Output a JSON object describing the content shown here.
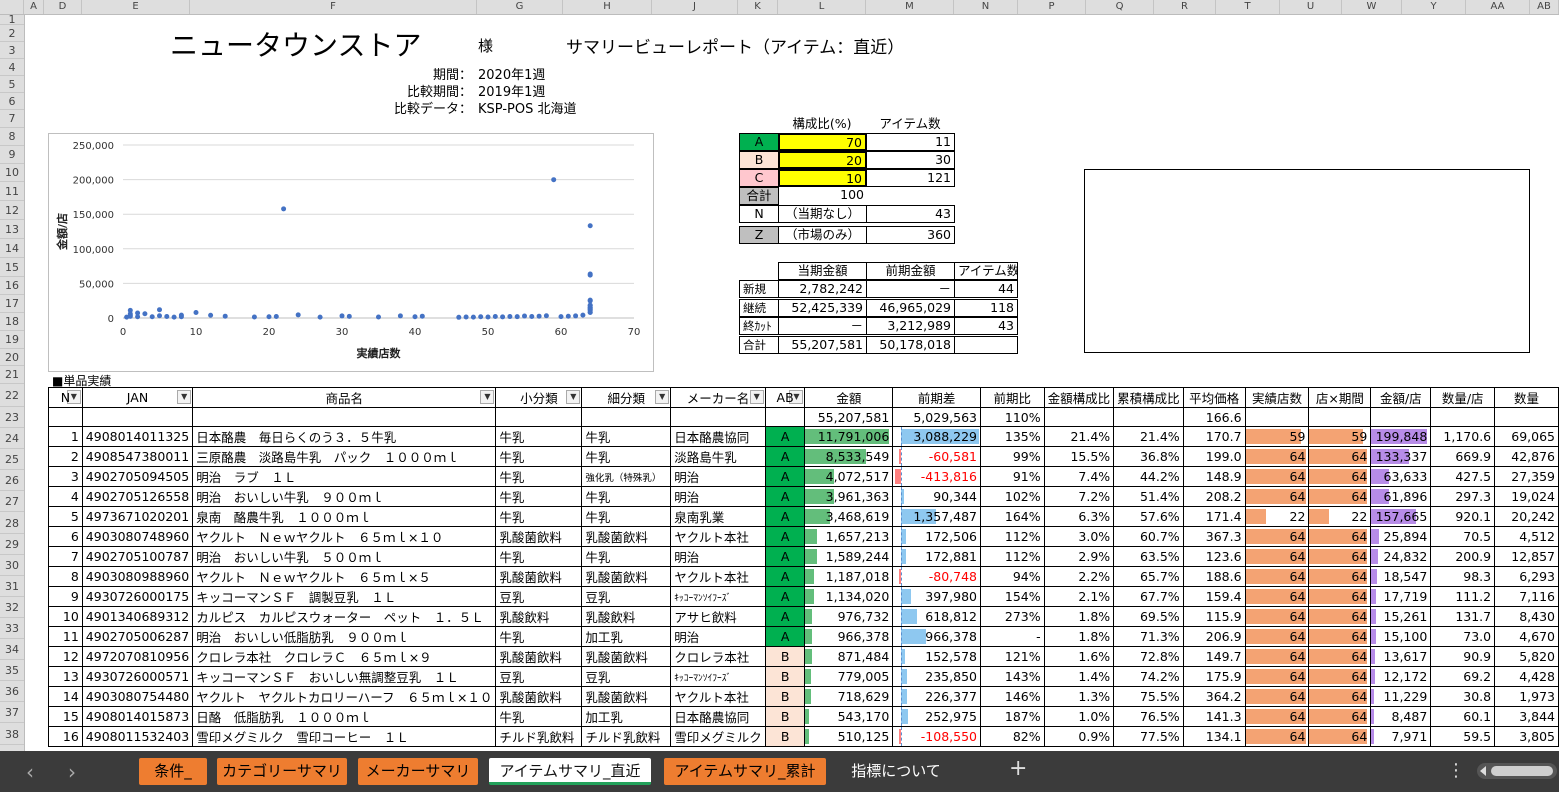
{
  "columns": [
    "A",
    "D",
    "E",
    "F",
    "G",
    "H",
    "J",
    "K",
    "L",
    "M",
    "N",
    "P",
    "Q",
    "R",
    "T",
    "U",
    "W",
    "Y",
    "AA",
    "AB"
  ],
  "rows": [
    "1",
    "2",
    "3",
    "4",
    "5",
    "6",
    "7",
    "8",
    "9",
    "10",
    "11",
    "12",
    "13",
    "14",
    "15",
    "16",
    "17",
    "18",
    "19",
    "20",
    "21",
    "22",
    "23",
    "24",
    "25",
    "26",
    "27",
    "28",
    "29",
    "30",
    "31",
    "32",
    "33",
    "34",
    "35",
    "36",
    "37",
    "38"
  ],
  "header": {
    "store": "ニュータウンストア",
    "sama": "様",
    "report_title": "サマリービューレポート（アイテム：直近）",
    "period_label": "期間：",
    "period_value": "2020年1週",
    "compare_period_label": "比較期間：",
    "compare_period_value": "2019年1週",
    "compare_data_label": "比較データ：",
    "compare_data_value": "KSP-POS  北海道"
  },
  "abc": {
    "h_ratio": "構成比(%)",
    "h_items": "アイテム数",
    "rows": [
      {
        "label": "A",
        "ratio": "70",
        "items": "11",
        "color": "#00b050"
      },
      {
        "label": "B",
        "ratio": "20",
        "items": "30",
        "color": "#fce4d6"
      },
      {
        "label": "C",
        "ratio": "10",
        "items": "121",
        "color": "#ffc7ce"
      }
    ],
    "total_label": "合計",
    "total_value": "100",
    "n_label": "N",
    "n_desc": "（当期なし）",
    "n_items": "43",
    "z_label": "Z",
    "z_desc": "（市場のみ）",
    "z_items": "360"
  },
  "summary": {
    "h_cur": "当期金額",
    "h_prev": "前期金額",
    "h_items": "アイテム数",
    "rows": [
      {
        "label": "新規",
        "cur": "2,782,242",
        "prev": "－",
        "items": "44"
      },
      {
        "label": "継続",
        "cur": "52,425,339",
        "prev": "46,965,029",
        "items": "118"
      },
      {
        "label": "終ｶｯﾄ",
        "cur": "－",
        "prev": "3,212,989",
        "items": "43"
      },
      {
        "label": "合計",
        "cur": "55,207,581",
        "prev": "50,178,018",
        "items": ""
      }
    ]
  },
  "chart_data": {
    "type": "scatter",
    "xlabel": "実績店数",
    "ylabel": "金額/店",
    "xlim": [
      0,
      70
    ],
    "ylim": [
      0,
      250000
    ],
    "xticks": [
      "0",
      "10",
      "20",
      "30",
      "40",
      "50",
      "60",
      "70"
    ],
    "yticks": [
      "0",
      "50,000",
      "100,000",
      "150,000",
      "200,000",
      "250,000"
    ],
    "points": [
      [
        22,
        157665
      ],
      [
        59,
        199848
      ],
      [
        64,
        133337
      ],
      [
        64,
        63633
      ],
      [
        64,
        61896
      ],
      [
        64,
        25894
      ],
      [
        64,
        24832
      ],
      [
        64,
        18547
      ],
      [
        64,
        17719
      ],
      [
        64,
        15261
      ],
      [
        64,
        15100
      ],
      [
        64,
        13617
      ],
      [
        64,
        12172
      ],
      [
        64,
        11229
      ],
      [
        64,
        8487
      ],
      [
        64,
        7971
      ],
      [
        63,
        4200
      ],
      [
        62,
        3000
      ],
      [
        61,
        2500
      ],
      [
        60,
        2000
      ],
      [
        58,
        3200
      ],
      [
        57,
        2600
      ],
      [
        56,
        2200
      ],
      [
        55,
        2800
      ],
      [
        54,
        1900
      ],
      [
        53,
        2100
      ],
      [
        52,
        1600
      ],
      [
        51,
        2200
      ],
      [
        50,
        1500
      ],
      [
        49,
        1800
      ],
      [
        48,
        1200
      ],
      [
        47,
        1400
      ],
      [
        46,
        1000
      ],
      [
        41,
        2600
      ],
      [
        40,
        1800
      ],
      [
        38,
        3100
      ],
      [
        35,
        1500
      ],
      [
        31,
        2400
      ],
      [
        30,
        3000
      ],
      [
        27,
        1200
      ],
      [
        24,
        4500
      ],
      [
        21,
        2200
      ],
      [
        20,
        1800
      ],
      [
        18,
        1400
      ],
      [
        14,
        2600
      ],
      [
        12,
        4000
      ],
      [
        10,
        8000
      ],
      [
        8,
        1800
      ],
      [
        8,
        4200
      ],
      [
        7,
        1200
      ],
      [
        6,
        2200
      ],
      [
        5,
        12000
      ],
      [
        5,
        3200
      ],
      [
        4,
        1800
      ],
      [
        3,
        6200
      ],
      [
        2,
        1800
      ],
      [
        2,
        7200
      ],
      [
        1,
        11000
      ],
      [
        1,
        6000
      ],
      [
        1,
        2400
      ],
      [
        1,
        4000
      ],
      [
        0.5,
        1200
      ]
    ]
  },
  "main": {
    "section_label": "■単品実績",
    "headers": [
      "N",
      "JAN",
      "商品名",
      "小分類",
      "細分類",
      "メーカー名",
      "AB",
      "金額",
      "前期差",
      "前期比",
      "金額構成比",
      "累積構成比",
      "平均価格",
      "実績店数",
      "店×期間",
      "金額/店",
      "数量/店",
      "数量"
    ],
    "totals": {
      "amount": "55,207,581",
      "diff": "5,029,563",
      "ratio": "110%",
      "avg": "166.6"
    },
    "rows": [
      {
        "n": "1",
        "jan": "4908014011325",
        "name": "日本酪農　毎日らくのう３．５牛乳",
        "cat": "牛乳",
        "sub": "牛乳",
        "maker": "日本酪農協同",
        "ab": "A",
        "amount": "11,791,006",
        "diff": "3,088,229",
        "ratio": "135%",
        "comp": "21.4%",
        "cum": "21.4%",
        "avg": "170.7",
        "stores": "59",
        "sp": "59",
        "ps": "199,848",
        "qs": "1,170.6",
        "qty": "69,065"
      },
      {
        "n": "2",
        "jan": "4908547380011",
        "name": "三原酪農　淡路島牛乳　パック　１０００ｍｌ",
        "cat": "牛乳",
        "sub": "牛乳",
        "maker": "淡路島牛乳",
        "ab": "A",
        "amount": "8,533,549",
        "diff": "-60,581",
        "ratio": "99%",
        "comp": "15.5%",
        "cum": "36.8%",
        "avg": "199.0",
        "stores": "64",
        "sp": "64",
        "ps": "133,337",
        "qs": "669.9",
        "qty": "42,876"
      },
      {
        "n": "3",
        "jan": "4902705094505",
        "name": "明治　ラブ　１Ｌ",
        "cat": "牛乳",
        "sub": "強化乳（特殊乳）",
        "maker": "明治",
        "ab": "A",
        "amount": "4,072,517",
        "diff": "-413,816",
        "ratio": "91%",
        "comp": "7.4%",
        "cum": "44.2%",
        "avg": "148.9",
        "stores": "64",
        "sp": "64",
        "ps": "63,633",
        "qs": "427.5",
        "qty": "27,359"
      },
      {
        "n": "4",
        "jan": "4902705126558",
        "name": "明治　おいしい牛乳　９００ｍｌ",
        "cat": "牛乳",
        "sub": "牛乳",
        "maker": "明治",
        "ab": "A",
        "amount": "3,961,363",
        "diff": "90,344",
        "ratio": "102%",
        "comp": "7.2%",
        "cum": "51.4%",
        "avg": "208.2",
        "stores": "64",
        "sp": "64",
        "ps": "61,896",
        "qs": "297.3",
        "qty": "19,024"
      },
      {
        "n": "5",
        "jan": "4973671020201",
        "name": "泉南　酪農牛乳　１０００ｍｌ",
        "cat": "牛乳",
        "sub": "牛乳",
        "maker": "泉南乳業",
        "ab": "A",
        "amount": "3,468,619",
        "diff": "1,357,487",
        "ratio": "164%",
        "comp": "6.3%",
        "cum": "57.6%",
        "avg": "171.4",
        "stores": "22",
        "sp": "22",
        "ps": "157,665",
        "qs": "920.1",
        "qty": "20,242"
      },
      {
        "n": "6",
        "jan": "4903080748960",
        "name": "ヤクルト　Ｎｅｗヤクルト　６５ｍｌ×１０",
        "cat": "乳酸菌飲料",
        "sub": "乳酸菌飲料",
        "maker": "ヤクルト本社",
        "ab": "A",
        "amount": "1,657,213",
        "diff": "172,506",
        "ratio": "112%",
        "comp": "3.0%",
        "cum": "60.7%",
        "avg": "367.3",
        "stores": "64",
        "sp": "64",
        "ps": "25,894",
        "qs": "70.5",
        "qty": "4,512"
      },
      {
        "n": "7",
        "jan": "4902705100787",
        "name": "明治　おいしい牛乳　５００ｍｌ",
        "cat": "牛乳",
        "sub": "牛乳",
        "maker": "明治",
        "ab": "A",
        "amount": "1,589,244",
        "diff": "172,881",
        "ratio": "112%",
        "comp": "2.9%",
        "cum": "63.5%",
        "avg": "123.6",
        "stores": "64",
        "sp": "64",
        "ps": "24,832",
        "qs": "200.9",
        "qty": "12,857"
      },
      {
        "n": "8",
        "jan": "4903080988960",
        "name": "ヤクルト　Ｎｅｗヤクルト　６５ｍｌ×５",
        "cat": "乳酸菌飲料",
        "sub": "乳酸菌飲料",
        "maker": "ヤクルト本社",
        "ab": "A",
        "amount": "1,187,018",
        "diff": "-80,748",
        "ratio": "94%",
        "comp": "2.2%",
        "cum": "65.7%",
        "avg": "188.6",
        "stores": "64",
        "sp": "64",
        "ps": "18,547",
        "qs": "98.3",
        "qty": "6,293"
      },
      {
        "n": "9",
        "jan": "4930726000175",
        "name": "キッコーマンＳＦ　調製豆乳　１Ｌ",
        "cat": "豆乳",
        "sub": "豆乳",
        "maker": "ｷｯｺｰﾏﾝｿｲﾌｰｽﾞ",
        "ab": "A",
        "amount": "1,134,020",
        "diff": "397,980",
        "ratio": "154%",
        "comp": "2.1%",
        "cum": "67.7%",
        "avg": "159.4",
        "stores": "64",
        "sp": "64",
        "ps": "17,719",
        "qs": "111.2",
        "qty": "7,116"
      },
      {
        "n": "10",
        "jan": "4901340689312",
        "name": "カルピス　カルピスウォーター　ペット　１．５Ｌ",
        "cat": "乳酸飲料",
        "sub": "乳酸飲料",
        "maker": "アサヒ飲料",
        "ab": "A",
        "amount": "976,732",
        "diff": "618,812",
        "ratio": "273%",
        "comp": "1.8%",
        "cum": "69.5%",
        "avg": "115.9",
        "stores": "64",
        "sp": "64",
        "ps": "15,261",
        "qs": "131.7",
        "qty": "8,430"
      },
      {
        "n": "11",
        "jan": "4902705006287",
        "name": "明治　おいしい低脂肪乳　９００ｍｌ",
        "cat": "牛乳",
        "sub": "加工乳",
        "maker": "明治",
        "ab": "A",
        "amount": "966,378",
        "diff": "966,378",
        "ratio": "-",
        "comp": "1.8%",
        "cum": "71.3%",
        "avg": "206.9",
        "stores": "64",
        "sp": "64",
        "ps": "15,100",
        "qs": "73.0",
        "qty": "4,670"
      },
      {
        "n": "12",
        "jan": "4972070810956",
        "name": "クロレラ本社　クロレラＣ　６５ｍｌ×９",
        "cat": "乳酸菌飲料",
        "sub": "乳酸菌飲料",
        "maker": "クロレラ本社",
        "ab": "B",
        "amount": "871,484",
        "diff": "152,578",
        "ratio": "121%",
        "comp": "1.6%",
        "cum": "72.8%",
        "avg": "149.7",
        "stores": "64",
        "sp": "64",
        "ps": "13,617",
        "qs": "90.9",
        "qty": "5,820"
      },
      {
        "n": "13",
        "jan": "4930726000571",
        "name": "キッコーマンＳＦ　おいしい無調整豆乳　１Ｌ",
        "cat": "豆乳",
        "sub": "豆乳",
        "maker": "ｷｯｺｰﾏﾝｿｲﾌｰｽﾞ",
        "ab": "B",
        "amount": "779,005",
        "diff": "235,850",
        "ratio": "143%",
        "comp": "1.4%",
        "cum": "74.2%",
        "avg": "175.9",
        "stores": "64",
        "sp": "64",
        "ps": "12,172",
        "qs": "69.2",
        "qty": "4,428"
      },
      {
        "n": "14",
        "jan": "4903080754480",
        "name": "ヤクルト　ヤクルトカロリーハーフ　６５ｍｌ×１０",
        "cat": "乳酸菌飲料",
        "sub": "乳酸菌飲料",
        "maker": "ヤクルト本社",
        "ab": "B",
        "amount": "718,629",
        "diff": "226,377",
        "ratio": "146%",
        "comp": "1.3%",
        "cum": "75.5%",
        "avg": "364.2",
        "stores": "64",
        "sp": "64",
        "ps": "11,229",
        "qs": "30.8",
        "qty": "1,973"
      },
      {
        "n": "15",
        "jan": "4908014015873",
        "name": "日酪　低脂肪乳　１０００ｍｌ",
        "cat": "牛乳",
        "sub": "加工乳",
        "maker": "日本酪農協同",
        "ab": "B",
        "amount": "543,170",
        "diff": "252,975",
        "ratio": "187%",
        "comp": "1.0%",
        "cum": "76.5%",
        "avg": "141.3",
        "stores": "64",
        "sp": "64",
        "ps": "8,487",
        "qs": "60.1",
        "qty": "3,844"
      },
      {
        "n": "16",
        "jan": "4908011532403",
        "name": "雪印メグミルク　雪印コーヒー　１Ｌ",
        "cat": "チルド乳飲料",
        "sub": "チルド乳飲料",
        "maker": "雪印メグミルク",
        "ab": "B",
        "amount": "510,125",
        "diff": "-108,550",
        "ratio": "82%",
        "comp": "0.9%",
        "cum": "77.5%",
        "avg": "134.1",
        "stores": "64",
        "sp": "64",
        "ps": "7,971",
        "qs": "59.5",
        "qty": "3,805"
      }
    ]
  },
  "tabs": [
    {
      "label": "条件_",
      "style": "orange"
    },
    {
      "label": "カテゴリーサマリ",
      "style": "orange"
    },
    {
      "label": "メーカーサマリ",
      "style": "orange"
    },
    {
      "label": "アイテムサマリ_直近",
      "style": "active"
    },
    {
      "label": "アイテムサマリ_累計",
      "style": "orange"
    },
    {
      "label": "指標について",
      "style": "plain"
    }
  ],
  "nav": {
    "prev": "‹",
    "next": "›",
    "add": "+",
    "more": "⋮"
  },
  "colors": {
    "green_bar": "#63be7b",
    "blue_bar": "#8ec8f0",
    "red_bar": "#ff8080",
    "orange_bar": "#f4a373",
    "purple_bar": "#b78ce8",
    "abc_yellow": "#ffff00",
    "tab_orange": "#ee7d30"
  }
}
